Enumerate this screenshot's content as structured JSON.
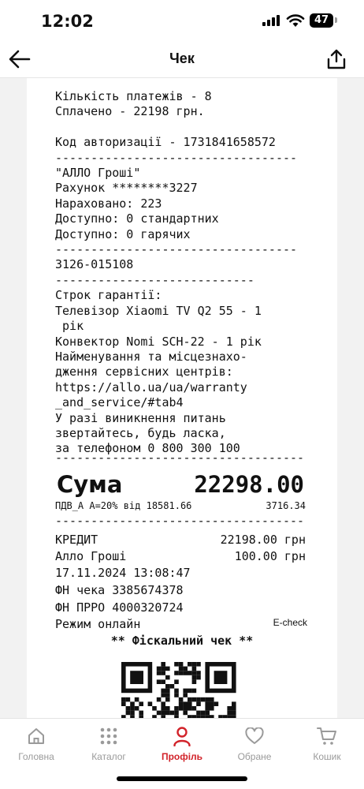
{
  "status": {
    "time": "12:02",
    "battery": "47"
  },
  "nav": {
    "title": "Чек"
  },
  "receipt": {
    "lines_top": [
      "Кількість платежів - 8",
      "Сплачено - 22198 грн.",
      "",
      "Код авторизації - 1731841658572",
      "----------------------------------",
      "\"АЛЛО Гроші\"",
      "Рахунок ********3227",
      "Нараховано: 223",
      "Доступно: 0 стандартних",
      "Доступно: 0 гарячих",
      "----------------------------------",
      "3126-015108",
      "----------------------------",
      "Строк гарантії:",
      "Телевізор Xiaomi TV Q2 55 - 1",
      " рік",
      "Конвектор Nomi SCH-22 - 1 рік",
      "Найменування та місцезнахо-",
      "дження сервісних центрів:",
      "https://allo.ua/ua/warranty",
      "_and_service/#tab4",
      "У разі виникнення питань",
      "звертайтесь, будь ласка,",
      "за телефоном 0 800 300 100"
    ],
    "divider": "-----------------------------------",
    "total_label": "Сума",
    "total_value": "22298.00",
    "vat_label": "ПДВ_А А=20% від 18581.66",
    "vat_amount": "3716.34",
    "credit_label": "КРЕДИТ",
    "credit_value": "22198.00 грн",
    "allo_label": "Алло Гроші",
    "allo_value": "100.00 грн",
    "datetime": "17.11.2024 13:08:47",
    "fn_check": "ФН чека 3385674378",
    "fn_prro": "ФН ПРРО 4000320724",
    "mode": "Режим онлайн",
    "echeck": "E-check",
    "fiscal": "** Фіскальний чек **"
  },
  "tabs": [
    {
      "label": "Головна",
      "icon": "home-icon"
    },
    {
      "label": "Каталог",
      "icon": "grid-icon"
    },
    {
      "label": "Профіль",
      "icon": "profile-icon"
    },
    {
      "label": "Обране",
      "icon": "heart-icon"
    },
    {
      "label": "Кошик",
      "icon": "cart-icon"
    }
  ],
  "colors": {
    "accent": "#d2232a",
    "inactive": "#9a9a9a"
  }
}
